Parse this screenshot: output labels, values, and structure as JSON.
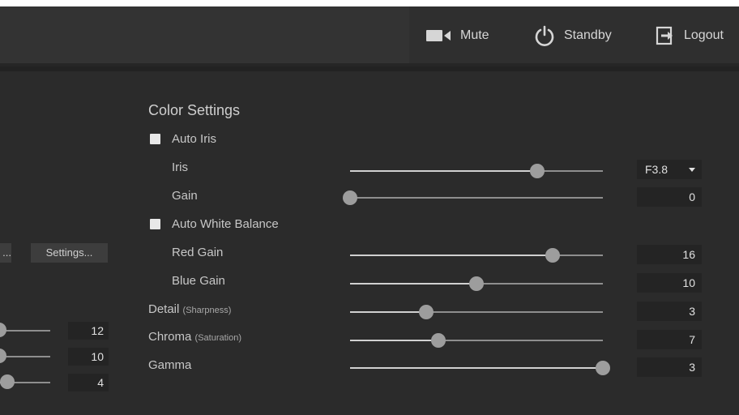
{
  "header": {
    "mute_label": "Mute",
    "standby_label": "Standby",
    "logout_label": "Logout"
  },
  "left_panel": {
    "partial_button_label": "...",
    "settings_button_label": "Settings...",
    "values": [
      "12",
      "10",
      "4"
    ]
  },
  "color_settings": {
    "title": "Color Settings",
    "auto_iris_label": "Auto Iris",
    "auto_iris_checked": false,
    "iris": {
      "label": "Iris",
      "value": "F3.8",
      "level": 0.74
    },
    "gain": {
      "label": "Gain",
      "value": "0",
      "level": 0.0
    },
    "auto_white_balance_label": "Auto White Balance",
    "auto_white_balance_checked": false,
    "red_gain": {
      "label": "Red Gain",
      "value": "16",
      "level": 0.8
    },
    "blue_gain": {
      "label": "Blue Gain",
      "value": "10",
      "level": 0.5
    },
    "detail": {
      "label": "Detail",
      "sublabel": "(Sharpness)",
      "value": "3",
      "level": 0.3
    },
    "chroma": {
      "label": "Chroma",
      "sublabel": "(Saturation)",
      "value": "7",
      "level": 0.35
    },
    "gamma": {
      "label": "Gamma",
      "value": "3",
      "level": 1.0
    }
  },
  "colors": {
    "background": "#2b2b2b",
    "header": "#333333",
    "field": "#242424"
  }
}
